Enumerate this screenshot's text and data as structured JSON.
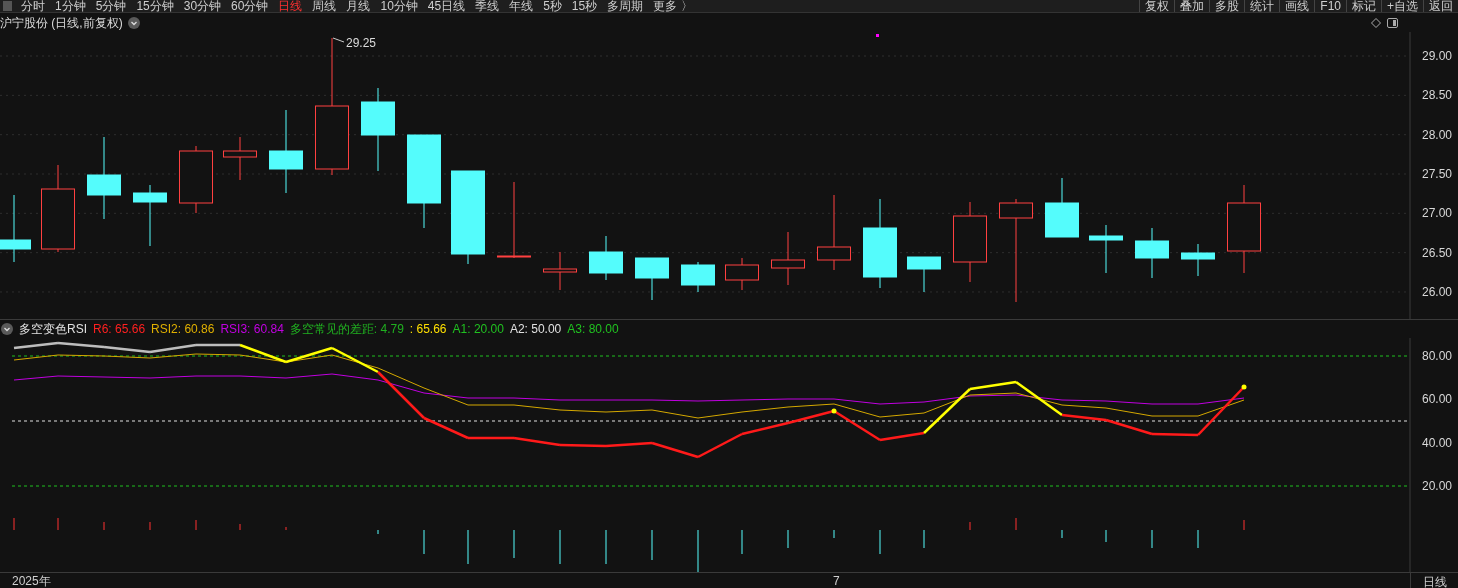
{
  "toolbar": {
    "periods": [
      {
        "label": "分时",
        "selected": false
      },
      {
        "label": "1分钟",
        "selected": false
      },
      {
        "label": "5分钟",
        "selected": false
      },
      {
        "label": "15分钟",
        "selected": false
      },
      {
        "label": "30分钟",
        "selected": false
      },
      {
        "label": "60分钟",
        "selected": false
      },
      {
        "label": "日线",
        "selected": true
      },
      {
        "label": "周线",
        "selected": false
      },
      {
        "label": "月线",
        "selected": false
      },
      {
        "label": "10分钟",
        "selected": false
      },
      {
        "label": "45日线",
        "selected": false
      },
      {
        "label": "季线",
        "selected": false
      },
      {
        "label": "年线",
        "selected": false
      },
      {
        "label": "5秒",
        "selected": false
      },
      {
        "label": "15秒",
        "selected": false
      },
      {
        "label": "多周期",
        "selected": false
      },
      {
        "label": "更多 〉",
        "selected": false
      }
    ],
    "actions": [
      "复权",
      "叠加",
      "多股",
      "统计",
      "画线",
      "F10",
      "标记",
      "+自选",
      "返回"
    ]
  },
  "price_chart": {
    "title": "沪宁股份 (日线,前复权)",
    "high_label": "29.25",
    "axis_labels": [
      "29.00",
      "28.50",
      "28.00",
      "27.50",
      "27.00",
      "26.50",
      "26.00"
    ]
  },
  "indicator": {
    "legend": [
      {
        "text": "多空变色RSI",
        "color": "#e0e0e0"
      },
      {
        "text": "R6: 65.66",
        "color": "#ff2020"
      },
      {
        "text": "RSI2: 60.86",
        "color": "#e0b000"
      },
      {
        "text": "RSI3: 60.84",
        "color": "#c000e0"
      },
      {
        "text": "多空常见的差距: 4.79",
        "color": "#20b020"
      },
      {
        "text": ": 65.66",
        "color": "#ffe000"
      },
      {
        "text": "A1: 20.00",
        "color": "#20c020"
      },
      {
        "text": "A2: 50.00",
        "color": "#e0e0e0"
      },
      {
        "text": "A3: 80.00",
        "color": "#20c020"
      }
    ],
    "axis_labels": [
      "80.00",
      "60.00",
      "40.00",
      "20.00"
    ]
  },
  "time_axis": {
    "labels": [
      "2025年",
      "7"
    ],
    "period": "日线"
  }
}
